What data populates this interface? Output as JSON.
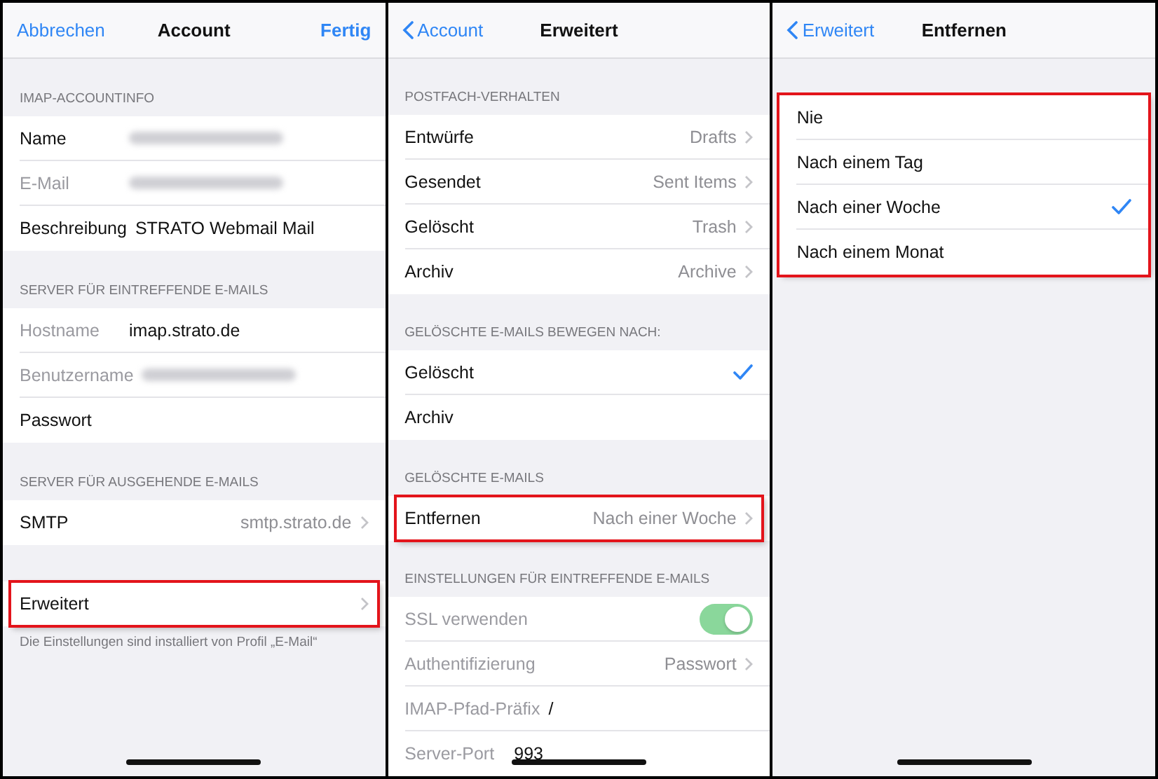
{
  "panels": [
    {
      "nav": {
        "left": {
          "label": "Abbrechen",
          "back": false
        },
        "title": "Account",
        "right": "Fertig"
      },
      "sections": [
        {
          "header": "IMAP-ACCOUNTINFO",
          "highlighted": false,
          "rows": [
            {
              "kind": "redacted",
              "label": "Name",
              "dimmed": false,
              "highlighted": false
            },
            {
              "kind": "redacted",
              "label": "E-Mail",
              "dimmed": true,
              "highlighted": false
            },
            {
              "kind": "field",
              "label": "Beschreibung",
              "value": "STRATO Webmail Mail",
              "dimmed": false,
              "highlighted": false
            }
          ]
        },
        {
          "header": "SERVER FÜR EINTREFFENDE E-MAILS",
          "highlighted": false,
          "rows": [
            {
              "kind": "field",
              "label": "Hostname",
              "value": "imap.strato.de",
              "dimmed": true,
              "highlighted": false
            },
            {
              "kind": "redacted",
              "label": "Benutzername",
              "dimmed": true,
              "highlighted": false
            },
            {
              "kind": "field",
              "label": "Passwort",
              "dimmed": false,
              "highlighted": false
            }
          ]
        },
        {
          "header": "SERVER FÜR AUSGEHENDE E-MAILS",
          "highlighted": false,
          "rows": [
            {
              "kind": "detail",
              "label": "SMTP",
              "value": "smtp.strato.de",
              "dimmed": false,
              "highlighted": false
            }
          ]
        },
        {
          "highlighted": false,
          "footer": "Die Einstellungen sind installiert von Profil „E-Mail“",
          "rows": [
            {
              "kind": "detail",
              "label": "Erweitert",
              "dimmed": false,
              "highlighted": true
            }
          ]
        }
      ]
    },
    {
      "nav": {
        "left": {
          "label": "Account",
          "back": true
        },
        "title": "Erweitert"
      },
      "sections": [
        {
          "header": "POSTFACH-VERHALTEN",
          "highlighted": false,
          "rows": [
            {
              "kind": "detail",
              "label": "Entwürfe",
              "value": "Drafts",
              "dimmed": false,
              "highlighted": false
            },
            {
              "kind": "detail",
              "label": "Gesendet",
              "value": "Sent Items",
              "dimmed": false,
              "highlighted": false
            },
            {
              "kind": "detail",
              "label": "Gelöscht",
              "value": "Trash",
              "dimmed": false,
              "highlighted": false
            },
            {
              "kind": "detail",
              "label": "Archiv",
              "value": "Archive",
              "dimmed": false,
              "highlighted": false
            }
          ]
        },
        {
          "header": "GELÖSCHTE E-MAILS BEWEGEN NACH:",
          "highlighted": false,
          "rows": [
            {
              "kind": "check",
              "label": "Gelöscht",
              "checked": true,
              "dimmed": false,
              "highlighted": false
            },
            {
              "kind": "check",
              "label": "Archiv",
              "checked": false,
              "dimmed": false,
              "highlighted": false
            }
          ]
        },
        {
          "header": "GELÖSCHTE E-MAILS",
          "highlighted": false,
          "rows": [
            {
              "kind": "detail",
              "label": "Entfernen",
              "value": "Nach einer Woche",
              "dimmed": false,
              "highlighted": true
            }
          ]
        },
        {
          "header": "EINSTELLUNGEN FÜR EINTREFFENDE E-MAILS",
          "highlighted": false,
          "rows": [
            {
              "kind": "toggle",
              "label": "SSL verwenden",
              "on": true,
              "dimmed": true,
              "highlighted": false
            },
            {
              "kind": "detail",
              "label": "Authentifizierung",
              "value": "Passwort",
              "dimmed": true,
              "highlighted": false
            },
            {
              "kind": "field",
              "label": "IMAP-Pfad-Präfix",
              "value": "/",
              "dimmed": true,
              "highlighted": false
            },
            {
              "kind": "field",
              "label": "Server-Port",
              "value": "993",
              "dimmed": true,
              "highlighted": false
            }
          ]
        }
      ]
    },
    {
      "nav": {
        "left": {
          "label": "Erweitert",
          "back": true
        },
        "title": "Entfernen"
      },
      "sections": [
        {
          "highlighted": true,
          "rows": [
            {
              "kind": "check",
              "label": "Nie",
              "checked": false,
              "dimmed": false,
              "highlighted": false
            },
            {
              "kind": "check",
              "label": "Nach einem Tag",
              "checked": false,
              "dimmed": false,
              "highlighted": false
            },
            {
              "kind": "check",
              "label": "Nach einer Woche",
              "checked": true,
              "dimmed": false,
              "highlighted": false
            },
            {
              "kind": "check",
              "label": "Nach einem Monat",
              "checked": false,
              "dimmed": false,
              "highlighted": false
            }
          ]
        }
      ]
    }
  ]
}
